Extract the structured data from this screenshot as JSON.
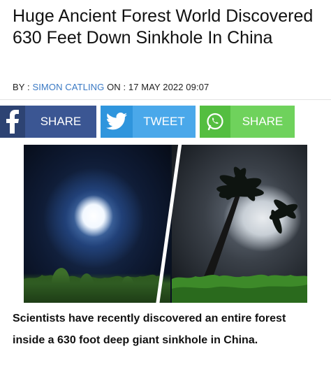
{
  "article": {
    "title": "Huge Ancient Forest World Discovered 630 Feet Down Sinkhole In China",
    "byline": {
      "by_label": "BY : ",
      "author": "SIMON CATLING",
      "on_label": " ON : ",
      "date": "17 MAY 2022 09:07"
    },
    "caption": "Scientists have recently discovered an entire forest inside a 630 foot deep giant sinkhole in China."
  },
  "share": {
    "facebook": {
      "label": "SHARE",
      "icon": "facebook-icon",
      "color": "#3b5693"
    },
    "twitter": {
      "label": "TWEET",
      "icon": "twitter-bird-icon",
      "color": "#4aa8ea"
    },
    "whatsapp": {
      "label": "SHARE",
      "icon": "whatsapp-icon",
      "color": "#6fd25c"
    }
  },
  "colors": {
    "author_link": "#3a79c4"
  }
}
